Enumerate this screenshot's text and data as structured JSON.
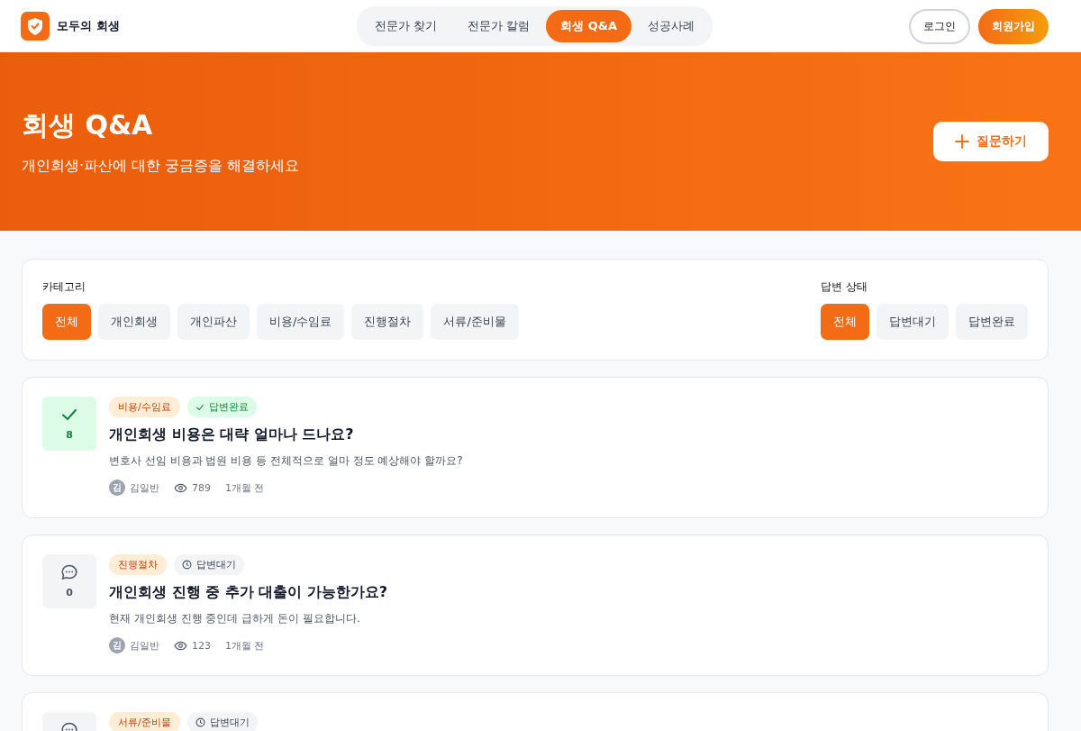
{
  "brand": {
    "name": "모두의 회생"
  },
  "nav": [
    {
      "label": "전문가 찾기",
      "selected": false
    },
    {
      "label": "전문가 칼럼",
      "selected": false
    },
    {
      "label": "회생 Q&A",
      "selected": true
    },
    {
      "label": "성공사례",
      "selected": false
    }
  ],
  "auth": {
    "login": "로그인",
    "signup": "회원가입"
  },
  "hero": {
    "title": "회생 Q&A",
    "subtitle": "개인회생·파산에 대한 궁금증을 해결하세요",
    "ask_button": "질문하기"
  },
  "filters": {
    "category_label": "카테고리",
    "categories": [
      {
        "label": "전체",
        "selected": true
      },
      {
        "label": "개인회생",
        "selected": false
      },
      {
        "label": "개인파산",
        "selected": false
      },
      {
        "label": "비용/수임료",
        "selected": false
      },
      {
        "label": "진행절차",
        "selected": false
      },
      {
        "label": "서류/준비물",
        "selected": false
      }
    ],
    "status_label": "답변 상태",
    "statuses": [
      {
        "label": "전체",
        "selected": true
      },
      {
        "label": "답변대기",
        "selected": false
      },
      {
        "label": "답변완료",
        "selected": false
      }
    ]
  },
  "questions": [
    {
      "category": "비용/수임료",
      "status": {
        "kind": "answered",
        "label": "답변완료"
      },
      "count": "8",
      "title": "개인회생 비용은 대략 얼마나 드나요?",
      "body": "변호사 선임 비용과 법원 비용 등 전체적으로 얼마 정도 예상해야 할까요?",
      "avatar": "김",
      "author": "김일반",
      "views": "789",
      "time": "1개월 전"
    },
    {
      "category": "진행절차",
      "status": {
        "kind": "waiting",
        "label": "답변대기"
      },
      "count": "0",
      "title": "개인회생 진행 중 추가 대출이 가능한가요?",
      "body": "현재 개인회생 진행 중인데 급하게 돈이 필요합니다.",
      "avatar": "김",
      "author": "김일반",
      "views": "123",
      "time": "1개월 전"
    },
    {
      "category": "서류/준비물",
      "status": {
        "kind": "waiting",
        "label": "답변대기"
      }
    }
  ]
}
